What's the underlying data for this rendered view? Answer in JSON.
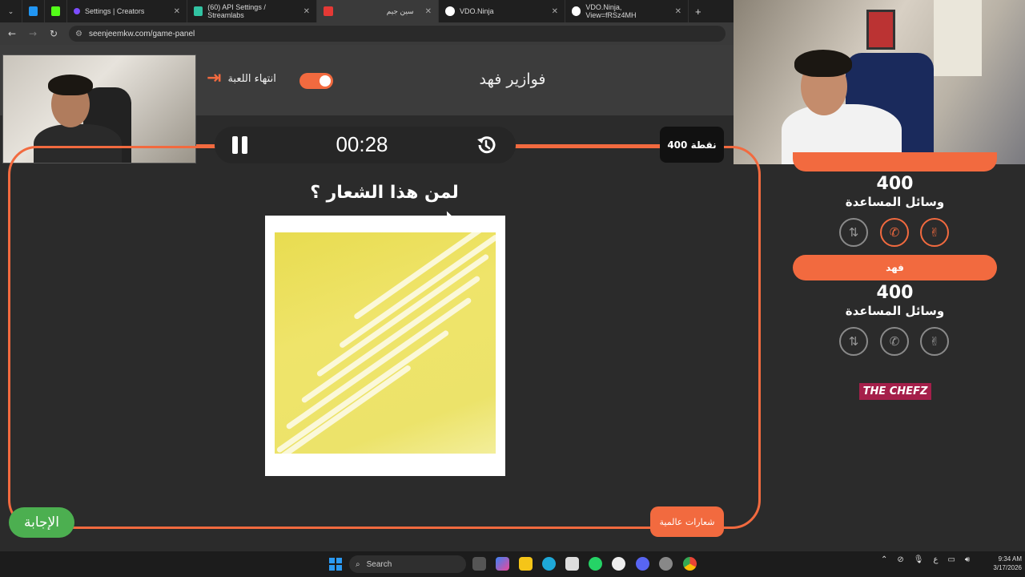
{
  "browser": {
    "tabs": [
      {
        "label": "",
        "icon": "app-icon",
        "color": "#2196f3"
      },
      {
        "label": "",
        "icon": "kick-icon",
        "color": "#53fc18"
      },
      {
        "label": "Settings | Creators",
        "icon": "creators-icon",
        "color": "#7c4dff"
      },
      {
        "label": "(60) API Settings / Streamlabs",
        "icon": "streamlabs-icon",
        "color": "#31c3a2"
      },
      {
        "label": "سين جيم",
        "icon": "seenjeem-icon",
        "color": "#e53935",
        "active": true
      },
      {
        "label": "VDO.Ninja",
        "icon": "vdo-ninja-icon",
        "color": "#ffffff"
      },
      {
        "label": "VDO.Ninja, View=fRSz4MH",
        "icon": "vdo-ninja-icon",
        "color": "#ffffff"
      }
    ],
    "new_tab": "+",
    "url": "seenjeemkw.com/game-panel"
  },
  "header": {
    "game_title": "فوازير فهد",
    "end_game_label": "انتهاء اللعبة"
  },
  "timer": {
    "time": "00:28",
    "points_badge": "400 نقطة"
  },
  "question": {
    "text": "لمن هذا الشعار ؟"
  },
  "buttons": {
    "answer": "الإجابة",
    "category": "شعارات عالمية"
  },
  "teams": [
    {
      "name": "",
      "score": "400",
      "help_label": "وسائل المساعدة",
      "lifelines_active": true
    },
    {
      "name": "فهد",
      "score": "400",
      "help_label": "وسائل المساعدة",
      "lifelines_active": false
    }
  ],
  "sponsor": "THE CHEFZ",
  "taskbar": {
    "search_placeholder": "Search",
    "tray_lang": "ع",
    "time": "9:34 AM",
    "date": "3/17/2026"
  },
  "colors": {
    "accent": "#f26a3f",
    "answer_green": "#4caf50",
    "panel_bg": "#2b2b2b"
  }
}
